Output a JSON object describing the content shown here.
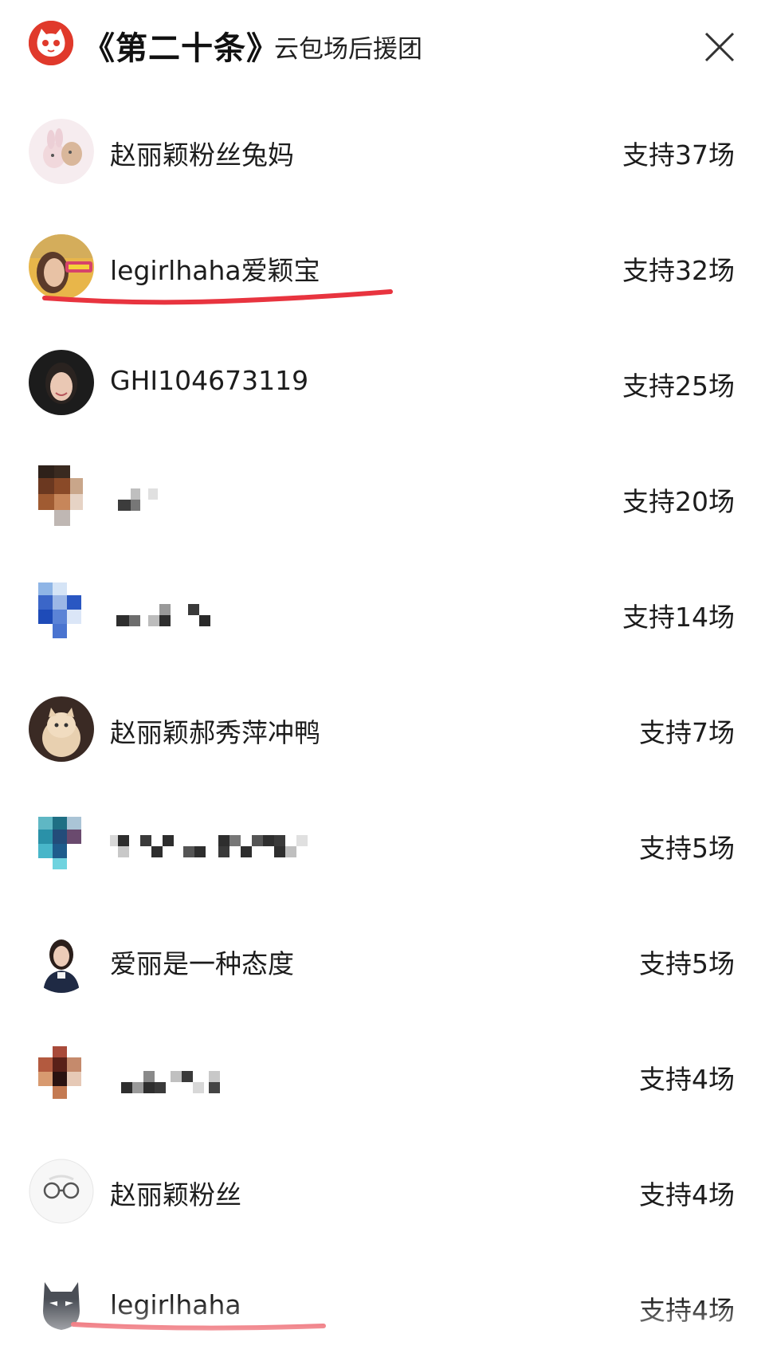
{
  "header": {
    "title": "《第二十条》",
    "subtitle": "云包场后援团",
    "logo_icon": "cat-logo-icon",
    "close_icon": "close-icon",
    "brand_color": "#e0392b"
  },
  "rows": [
    {
      "name": "赵丽颖粉丝兔妈",
      "support": "支持37场",
      "avatar": "cartoon-rabbit-avatar"
    },
    {
      "name": "legirlhaha爱颖宝",
      "support": "支持32场",
      "avatar": "photo-avatar",
      "underlined": true
    },
    {
      "name": "GHI104673119",
      "support": "支持25场",
      "avatar": "portrait-avatar"
    },
    {
      "name": "",
      "support": "支持20场",
      "avatar": "pixelated-avatar",
      "blurred": true
    },
    {
      "name": "",
      "support": "支持14场",
      "avatar": "pixelated-avatar",
      "blurred": true
    },
    {
      "name": "赵丽颖郝秀萍冲鸭",
      "support": "支持7场",
      "avatar": "cat-photo-avatar"
    },
    {
      "name": "",
      "support": "支持5场",
      "avatar": "pixelated-avatar",
      "blurred": true
    },
    {
      "name": "爱丽是一种态度",
      "support": "支持5场",
      "avatar": "person-avatar"
    },
    {
      "name": "",
      "support": "支持4场",
      "avatar": "pixelated-avatar",
      "blurred": true
    },
    {
      "name": "赵丽颖粉丝",
      "support": "支持4场",
      "avatar": "glasses-avatar"
    },
    {
      "name": "legirlhaha",
      "support": "支持4场",
      "avatar": "batman-avatar",
      "underlined": true
    }
  ],
  "annotation_color": "#e8343f"
}
